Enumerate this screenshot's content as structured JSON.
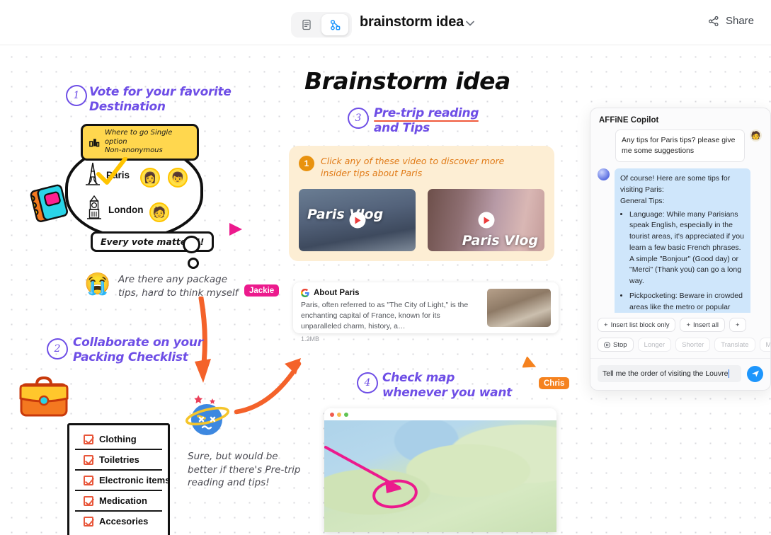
{
  "header": {
    "page_mode_icon": "page-mode-icon",
    "edgeless_mode_icon": "edgeless-mode-icon",
    "title": "brainstorm idea",
    "caret_icon": "chevron-down-icon",
    "share_icon": "share-icon",
    "share_label": "Share"
  },
  "board": {
    "title": "Brainstorm idea",
    "steps": [
      {
        "num": "1",
        "line1": "Vote for your favorite",
        "line2": "Destination"
      },
      {
        "num": "2",
        "line1": "Collaborate on your",
        "line2": "Packing Checklist"
      },
      {
        "num": "3",
        "line1": "Pre-trip reading",
        "line2": "and Tips"
      },
      {
        "num": "4",
        "line1": "Check map",
        "line2": "whenever you want"
      }
    ]
  },
  "poll": {
    "tag_icon": "bar-chart-icon",
    "tag_line1": "Where to go Single option",
    "tag_line2": "Non-anonymous",
    "options": [
      {
        "icon": "eiffel-tower-icon",
        "label": "Paris",
        "voters": [
          "👩",
          "👦"
        ],
        "checked": true
      },
      {
        "icon": "big-ben-icon",
        "label": "London",
        "voters": [
          "🧑"
        ],
        "checked": false
      }
    ],
    "footer_note": "Every vote matters!!"
  },
  "notes": {
    "crying": {
      "emoji": "😭",
      "line1": "Are there any package",
      "line2": "tips, hard to think myself"
    },
    "dizzy": {
      "emoji": "dizzy-face-icon",
      "line1": "Sure, but would be",
      "line2": "better if there's Pre-trip",
      "line3": "reading and tips!"
    }
  },
  "checklist": {
    "suitcase_icon": "suitcase-icon",
    "items": [
      {
        "label": "Clothing",
        "checked": true
      },
      {
        "label": "Toiletries",
        "checked": true
      },
      {
        "label": "Electronic items",
        "checked": true
      },
      {
        "label": "Medication",
        "checked": true
      },
      {
        "label": "Accesories",
        "checked": true
      }
    ]
  },
  "tips_card": {
    "badge": "1",
    "line1": "Click any of these video to discover more",
    "line2": "insider tips about Paris",
    "videos": [
      {
        "label": "Paris Vlog",
        "play_icon": "play-icon"
      },
      {
        "label": "Paris Vlog",
        "play_icon": "play-icon"
      }
    ]
  },
  "link_card": {
    "favicon": "google-icon",
    "title": "About Paris",
    "description": "Paris, often referred to as \"The City of Light,\" is the enchanting capital of France, known for its unparalleled charm, history, a…",
    "size": "1.2MB",
    "thumb_icon": "eiffel-tower-photo"
  },
  "map": {
    "dots": [
      "#f05c4f",
      "#f5bd4f",
      "#60c453"
    ],
    "annotation_icon": "pink-arrow-circle"
  },
  "cursors": [
    {
      "name": "Jackie",
      "color": "#ec1a8d"
    },
    {
      "name": "Chris",
      "color": "#f5821f"
    }
  ],
  "stickers": {
    "notebook": "notebook-sticker",
    "suitcase": "suitcase-sticker"
  },
  "copilot": {
    "title": "AFFiNE Copilot",
    "user_message": "Any tips for Paris tips? please give me some suggestions",
    "user_avatar": "user-avatar",
    "ai_avatar": "ai-avatar",
    "ai_intro_line1": "Of course! Here are some tips for visiting Paris:",
    "ai_intro_line2": "General Tips:",
    "ai_bullets": [
      "Language: While many Parisians speak English, especially in the tourist areas, it's appreciated if you learn a few basic French phrases. A simple \"Bonjour\" (Good day) or \"Merci\" (Thank you) can go a long way.",
      "Pickpocketing: Beware in crowded areas like the metro or popular tourist sites. Keep your belongings secure and consider using a money belt."
    ],
    "insert_actions": [
      {
        "icon": "plus-icon",
        "label": "Insert list block only"
      },
      {
        "icon": "plus-icon",
        "label": "Insert all"
      },
      {
        "icon": "plus-icon",
        "label": ""
      }
    ],
    "tools": [
      {
        "icon": "stop-icon",
        "label": "Stop",
        "disabled": false
      },
      {
        "icon": "",
        "label": "Longer",
        "disabled": true
      },
      {
        "icon": "",
        "label": "Shorter",
        "disabled": true
      },
      {
        "icon": "",
        "label": "Translate",
        "disabled": true
      },
      {
        "icon": "",
        "label": "Mo",
        "disabled": true
      }
    ],
    "input_value": "Tell me the order of visiting the Louvre",
    "send_icon": "send-icon"
  }
}
